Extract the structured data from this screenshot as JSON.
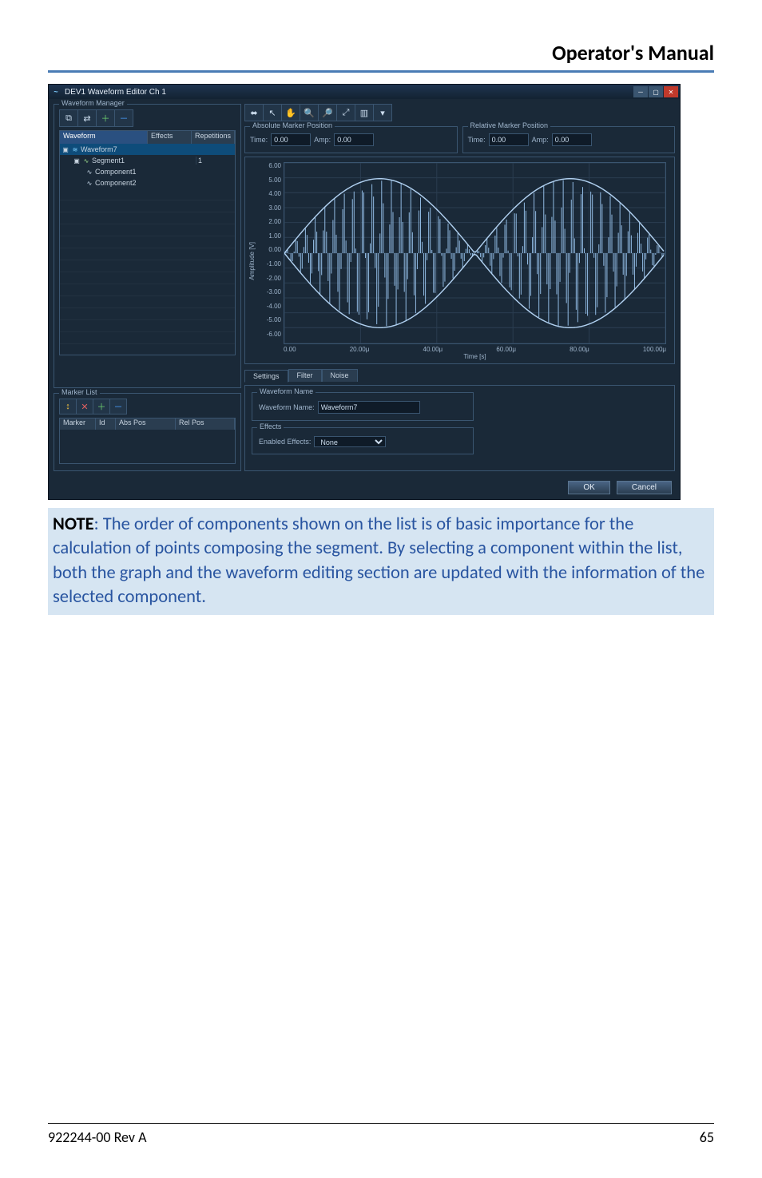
{
  "page": {
    "header_title": "Operator's Manual",
    "footer_left": "922244-00 Rev A",
    "footer_right": "65"
  },
  "note": {
    "label": "NOTE",
    "text": ": The order of components shown on the list is of basic importance for the calculation of points composing the segment. By selecting a component within the list, both the graph and the waveform editing section are updated with the information of the selected component."
  },
  "app": {
    "titlebar": "DEV1 Waveform Editor Ch 1",
    "wave_mgr_title": "Waveform Manager",
    "marker_list_title": "Marker List",
    "tree_headers": {
      "waveform": "Waveform",
      "effects": "Effects",
      "repetitions": "Repetitions"
    },
    "tree": {
      "r0": {
        "name": "Waveform7",
        "rep": ""
      },
      "r1": {
        "name": "Segment1",
        "rep": "1"
      },
      "r2": {
        "name": "Component1",
        "rep": ""
      },
      "r3": {
        "name": "Component2",
        "rep": ""
      }
    },
    "marker_headers": {
      "marker": "Marker",
      "id": "Id",
      "abspos": "Abs Pos",
      "relpos": "Rel Pos"
    },
    "abs_marker_title": "Absolute Marker Position",
    "rel_marker_title": "Relative Marker Position",
    "time_label": "Time:",
    "amp_label": "Amp:",
    "abs_time": "0.00",
    "abs_amp": "0.00",
    "rel_time": "0.00",
    "rel_amp": "0.00",
    "yaxis_label": "Amplitude [V]",
    "xaxis_label": "Time [s]",
    "yticks": [
      "6.00",
      "5.00",
      "4.00",
      "3.00",
      "2.00",
      "1.00",
      "0.00",
      "-1.00",
      "-2.00",
      "-3.00",
      "-4.00",
      "-5.00",
      "-6.00"
    ],
    "xticks": [
      "0.00",
      "20.00μ",
      "40.00μ",
      "60.00μ",
      "80.00μ",
      "100.00μ"
    ],
    "tabs": {
      "settings": "Settings",
      "filter": "Filter",
      "noise": "Noise"
    },
    "wf_name_group": "Waveform Name",
    "wf_name_label": "Waveform Name:",
    "wf_name_value": "Waveform7",
    "effects_group": "Effects",
    "effects_label": "Enabled Effects:",
    "effects_value": "None",
    "ok": "OK",
    "cancel": "Cancel"
  },
  "chart_data": {
    "type": "line",
    "title": "",
    "xlabel": "Time [s]",
    "ylabel": "Amplitude [V]",
    "xlim": [
      0,
      0.0001
    ],
    "ylim": [
      -6,
      6
    ],
    "series": [
      {
        "name": "Component1",
        "description": "Amplitude-modulated sine: carrier ≈ (visual high-freq fill), envelope two full sine lobes over 0–100μs peaking at ±5V",
        "envelope_x_us": [
          0,
          25,
          50,
          75,
          100
        ],
        "envelope_y": [
          0,
          5,
          0,
          5,
          0
        ]
      },
      {
        "name": "Component2",
        "description": "Mirror envelope (negative), producing symmetric lobes",
        "envelope_x_us": [
          0,
          25,
          50,
          75,
          100
        ],
        "envelope_y": [
          0,
          -5,
          0,
          -5,
          0
        ]
      }
    ]
  }
}
